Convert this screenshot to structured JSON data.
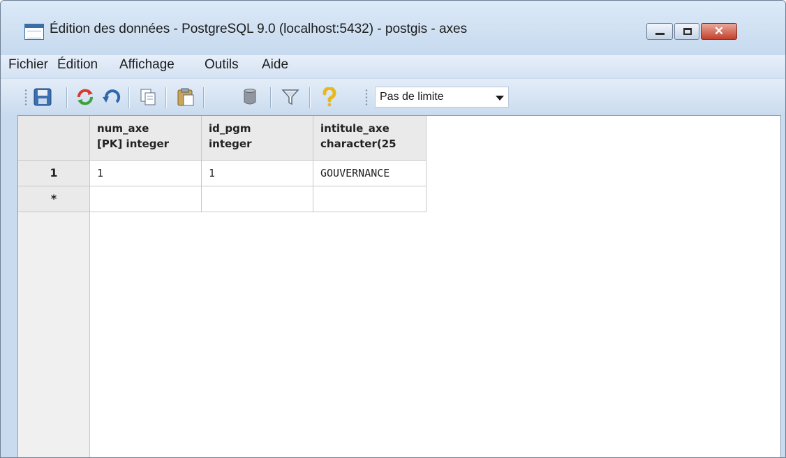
{
  "window": {
    "title": "Édition des données - PostgreSQL 9.0 (localhost:5432) - postgis - axes",
    "close_glyph": "✕"
  },
  "menubar": {
    "items": [
      "Fichier",
      "Édition",
      "Affichage",
      "Outils",
      "Aide"
    ]
  },
  "toolbar": {
    "icons": [
      "save-icon",
      "refresh-icon",
      "undo-icon",
      "copy-icon",
      "paste-icon",
      "delete-icon",
      "filter-icon",
      "help-icon"
    ],
    "limit_select": {
      "value": "Pas de limite"
    }
  },
  "grid": {
    "columns": [
      {
        "name": "num_axe",
        "type": "[PK] integer"
      },
      {
        "name": "id_pgm",
        "type": "integer"
      },
      {
        "name": "intitule_axe",
        "type": "character(25"
      }
    ],
    "rows": [
      {
        "marker": "1",
        "cells": [
          "1",
          "1",
          "GOUVERNANCE"
        ]
      },
      {
        "marker": "*",
        "cells": [
          "",
          "",
          ""
        ]
      }
    ]
  },
  "colors": {
    "titlebar": "#c6d9ee",
    "close_button": "#c3412b",
    "grid_header": "#eaeaea"
  }
}
